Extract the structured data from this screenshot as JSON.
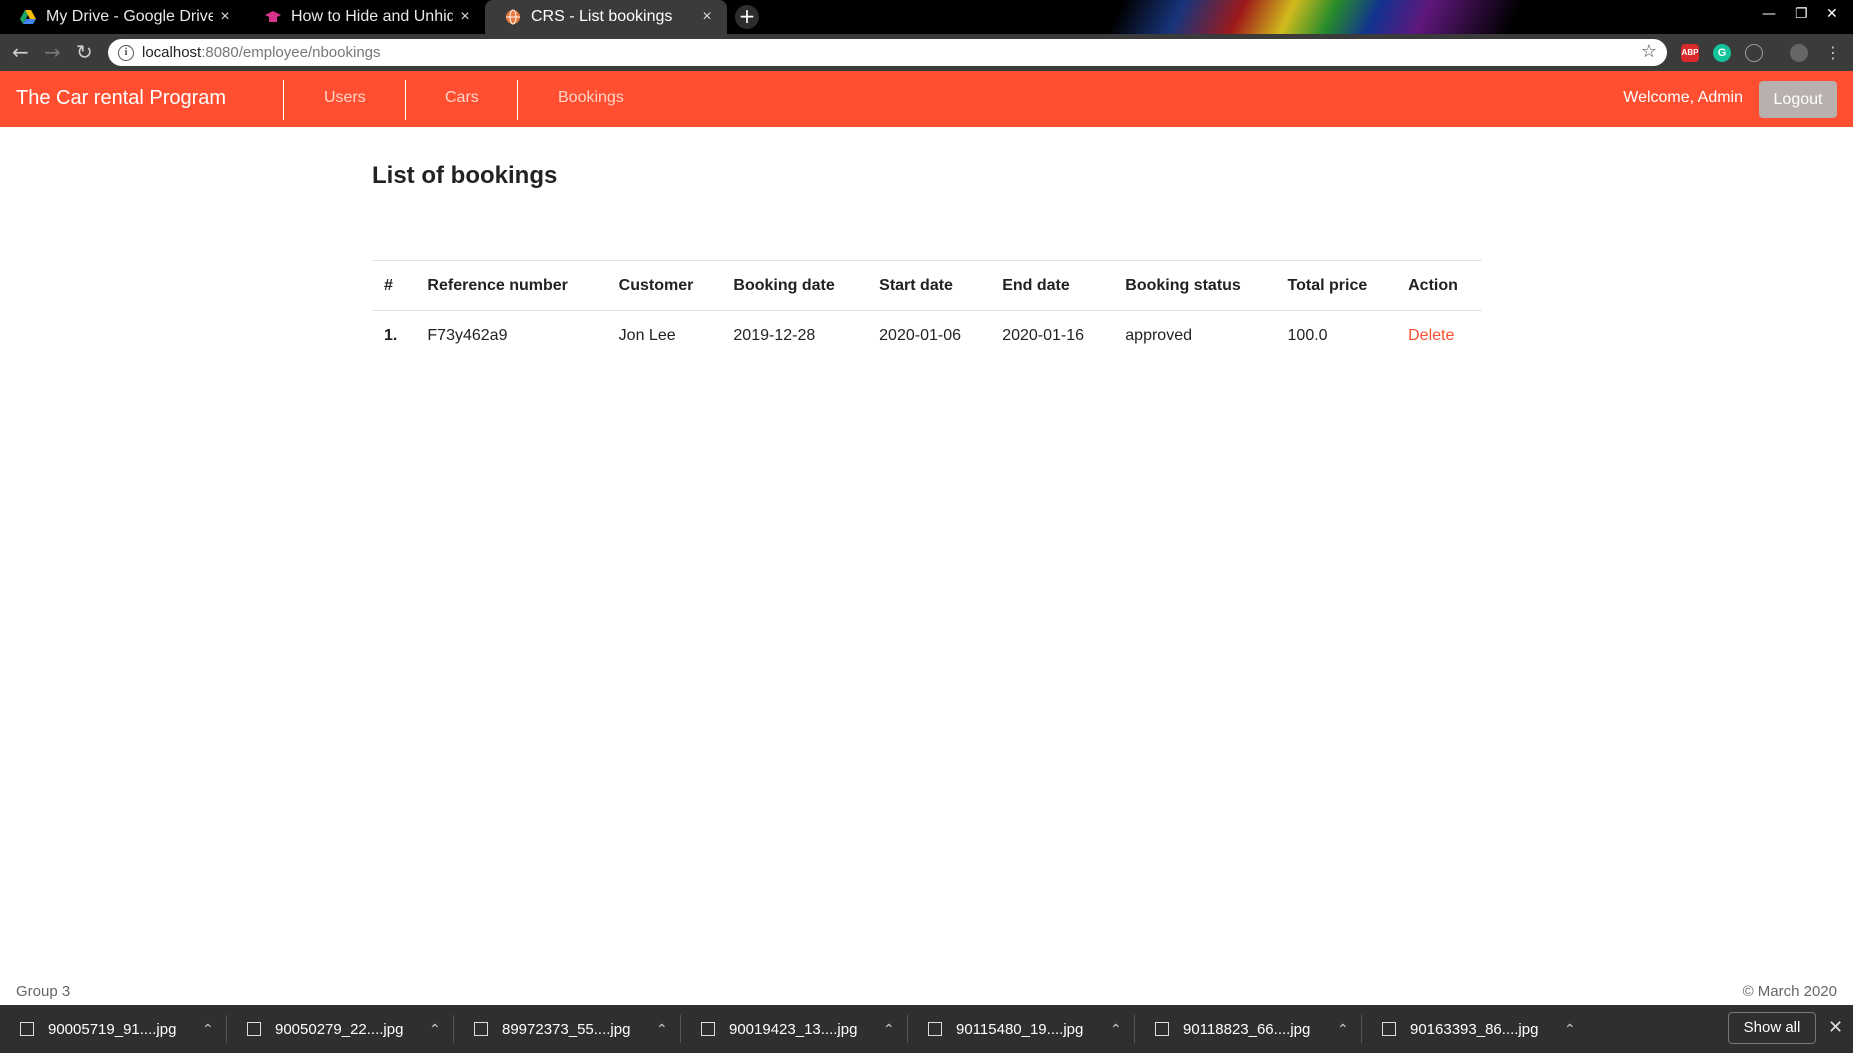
{
  "browser": {
    "tabs": [
      {
        "title": "My Drive - Google Drive",
        "close": "×"
      },
      {
        "title": "How to Hide and Unhide F",
        "close": "×"
      },
      {
        "title": "CRS - List bookings",
        "close": "×"
      }
    ],
    "new_tab": "+",
    "url_host": "localhost",
    "url_path": ":8080/employee/nbookings",
    "extensions": [
      "ABP",
      "G"
    ]
  },
  "navbar": {
    "brand": "The Car rental Program",
    "links": [
      "Users",
      "Cars",
      "Bookings"
    ],
    "welcome": "Welcome, Admin",
    "logout": "Logout"
  },
  "main": {
    "title": "List of bookings",
    "table": {
      "headers": [
        "#",
        "Reference number",
        "Customer",
        "Booking date",
        "Start date",
        "End date",
        "Booking status",
        "Total price",
        "Action"
      ],
      "rows": [
        {
          "num": "1.",
          "reference": "F73y462a9",
          "customer": "Jon Lee",
          "booking_date": "2019-12-28",
          "start_date": "2020-01-06",
          "end_date": "2020-01-16",
          "status": "approved",
          "total_price": "100.0",
          "action": "Delete"
        }
      ]
    }
  },
  "footer": {
    "left": "Group 3",
    "right": "© March 2020"
  },
  "downloads": {
    "items": [
      "90005719_91....jpg",
      "90050279_22....jpg",
      "89972373_55....jpg",
      "90019423_13....jpg",
      "90115480_19....jpg",
      "90118823_66....jpg",
      "90163393_86....jpg"
    ],
    "show_all": "Show all"
  },
  "colors": {
    "accent": "#ff4f30",
    "logout_bg": "#b8b0ae"
  }
}
